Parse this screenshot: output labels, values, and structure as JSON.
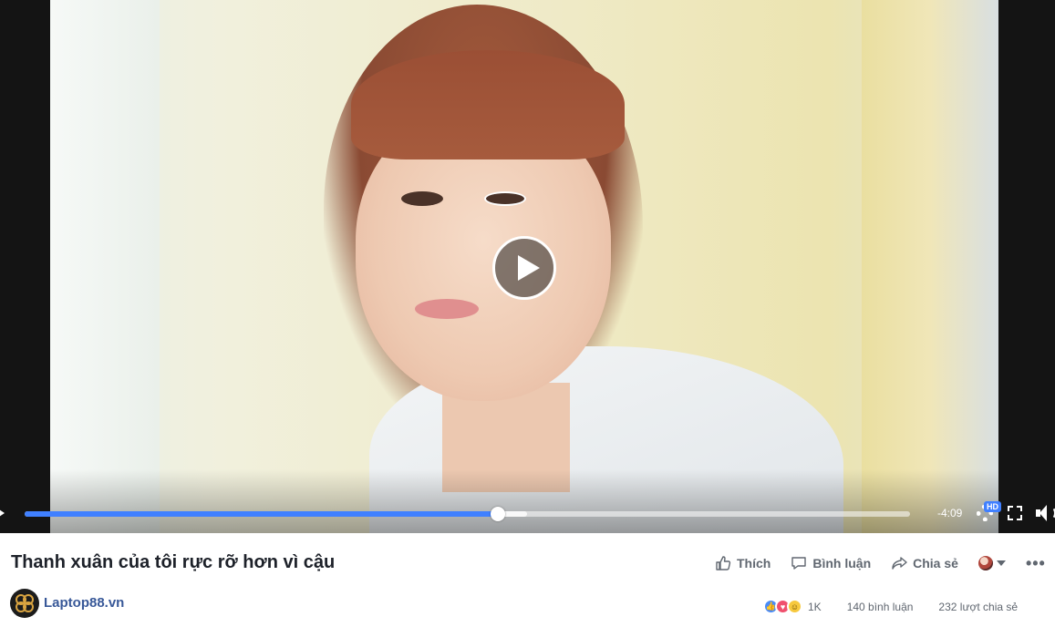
{
  "video": {
    "time_remaining": "-4:09",
    "progress_played": 0.535,
    "progress_buffered": 0.567,
    "quality_badge": "HD",
    "controls": {
      "play_icon": "play-icon",
      "settings_icon": "gear-icon",
      "fullscreen_icon": "fullscreen-icon",
      "volume_icon": "volume-icon"
    },
    "accent_color": "#4080ff"
  },
  "post": {
    "title": "Thanh xuân của tôi rực rỡ hơn vì cậu",
    "page_name": "Laptop88.vn"
  },
  "actions": {
    "like": "Thích",
    "comment": "Bình luận",
    "share": "Chia sẻ",
    "more": "•••"
  },
  "stats": {
    "reactions_count": "1K",
    "comments": "140 bình luận",
    "shares": "232 lượt chia sẻ",
    "reaction_icons": [
      "like-icon",
      "love-icon",
      "haha-icon"
    ]
  },
  "colors": {
    "link": "#385898",
    "like": "#4a8cf7",
    "love": "#f0506e",
    "haha": "#f7c93e"
  }
}
